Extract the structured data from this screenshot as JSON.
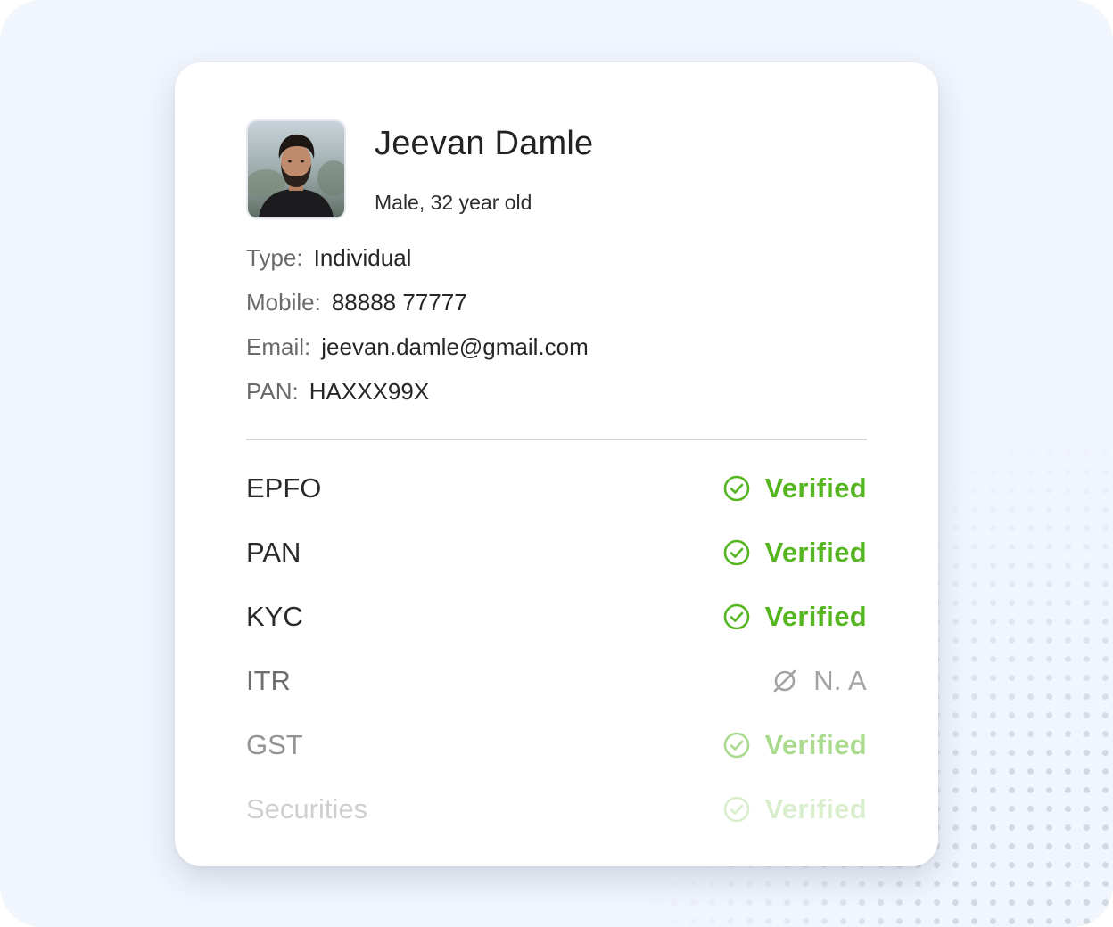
{
  "profile": {
    "name": "Jeevan Damle",
    "subtitle": "Male, 32 year old"
  },
  "details": [
    {
      "label": "Type:",
      "value": "Individual"
    },
    {
      "label": "Mobile:",
      "value": "88888 77777"
    },
    {
      "label": "Email:",
      "value": "jeevan.damle@gmail.com"
    },
    {
      "label": "PAN:",
      "value": "HAXXX99X"
    }
  ],
  "verifications": [
    {
      "label": "EPFO",
      "status": "Verified",
      "icon": "check-circle-icon"
    },
    {
      "label": "PAN",
      "status": "Verified",
      "icon": "check-circle-icon"
    },
    {
      "label": "KYC",
      "status": "Verified",
      "icon": "check-circle-icon"
    },
    {
      "label": "ITR",
      "status": "N. A",
      "icon": "not-applicable-icon"
    },
    {
      "label": "GST",
      "status": "Verified",
      "icon": "check-circle-icon"
    },
    {
      "label": "Securities",
      "status": "Verified",
      "icon": "check-circle-icon"
    }
  ],
  "colors": {
    "verified": "#55b620",
    "not_applicable": "#a3a3a3",
    "background": "#f1f5fd",
    "card": "#ffffff"
  }
}
